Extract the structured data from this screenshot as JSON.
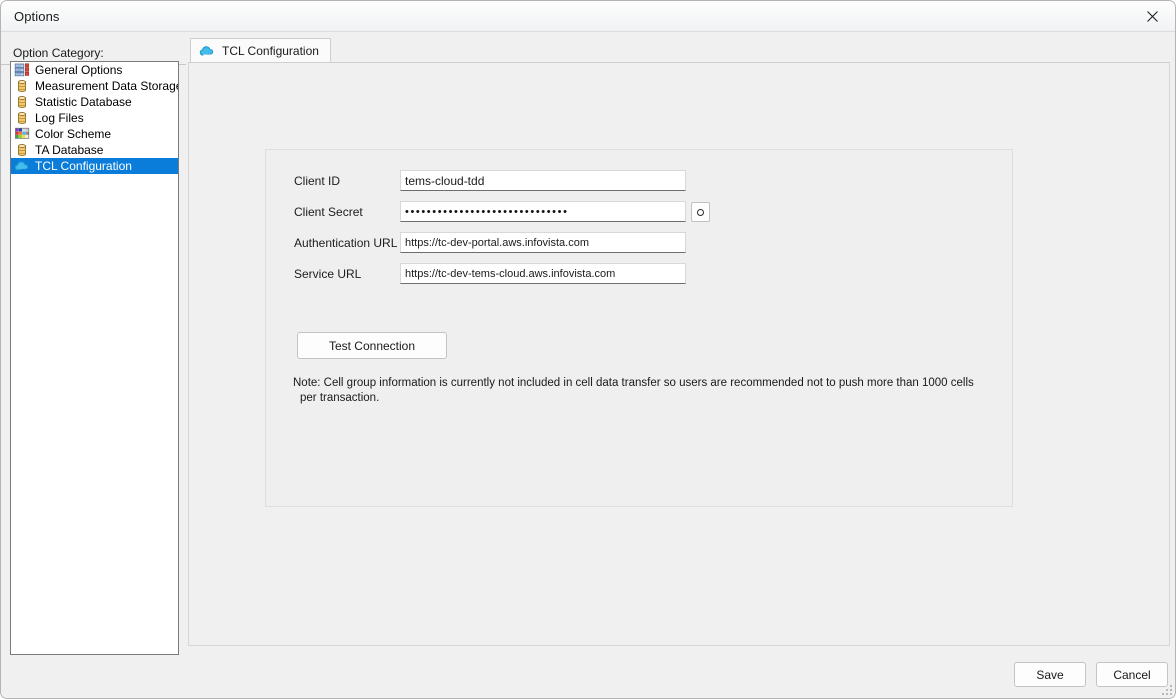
{
  "window": {
    "title": "Options",
    "close_icon": "close-icon"
  },
  "sidebar": {
    "header": "Option Category:",
    "items": [
      {
        "label": "General Options",
        "icon": "list-settings-icon",
        "selected": false
      },
      {
        "label": "Measurement Data Storage",
        "icon": "database-icon",
        "selected": false
      },
      {
        "label": "Statistic Database",
        "icon": "database-icon",
        "selected": false
      },
      {
        "label": "Log Files",
        "icon": "database-icon",
        "selected": false
      },
      {
        "label": "Color Scheme",
        "icon": "color-palette-icon",
        "selected": false
      },
      {
        "label": "TA Database",
        "icon": "database-icon",
        "selected": false
      },
      {
        "label": "TCL Configuration",
        "icon": "cloud-icon",
        "selected": true
      }
    ],
    "selection_color": "#0a7ddb"
  },
  "tabs": [
    {
      "label": "TCL Configuration",
      "icon": "cloud-icon",
      "active": true
    }
  ],
  "form": {
    "fields": [
      {
        "label": "Client ID",
        "value": "tems-cloud-tdd",
        "type": "text"
      },
      {
        "label": "Client Secret",
        "value": "••••••••••••••••••••••••••••••",
        "type": "password"
      },
      {
        "label": "Authentication URL",
        "value": "https://tc-dev-portal.aws.infovista.com",
        "type": "text"
      },
      {
        "label": "Service URL",
        "value": "https://tc-dev-tems-cloud.aws.infovista.com",
        "type": "text"
      }
    ],
    "reveal_secret_icon": "eye-circle-icon",
    "test_connection_label": "Test Connection",
    "note_line1": "Note: Cell group information is currently not included in cell data transfer so users are recommended not to push more than 1000 cells",
    "note_line2": "per transaction."
  },
  "footer": {
    "save_label": "Save",
    "cancel_label": "Cancel"
  }
}
